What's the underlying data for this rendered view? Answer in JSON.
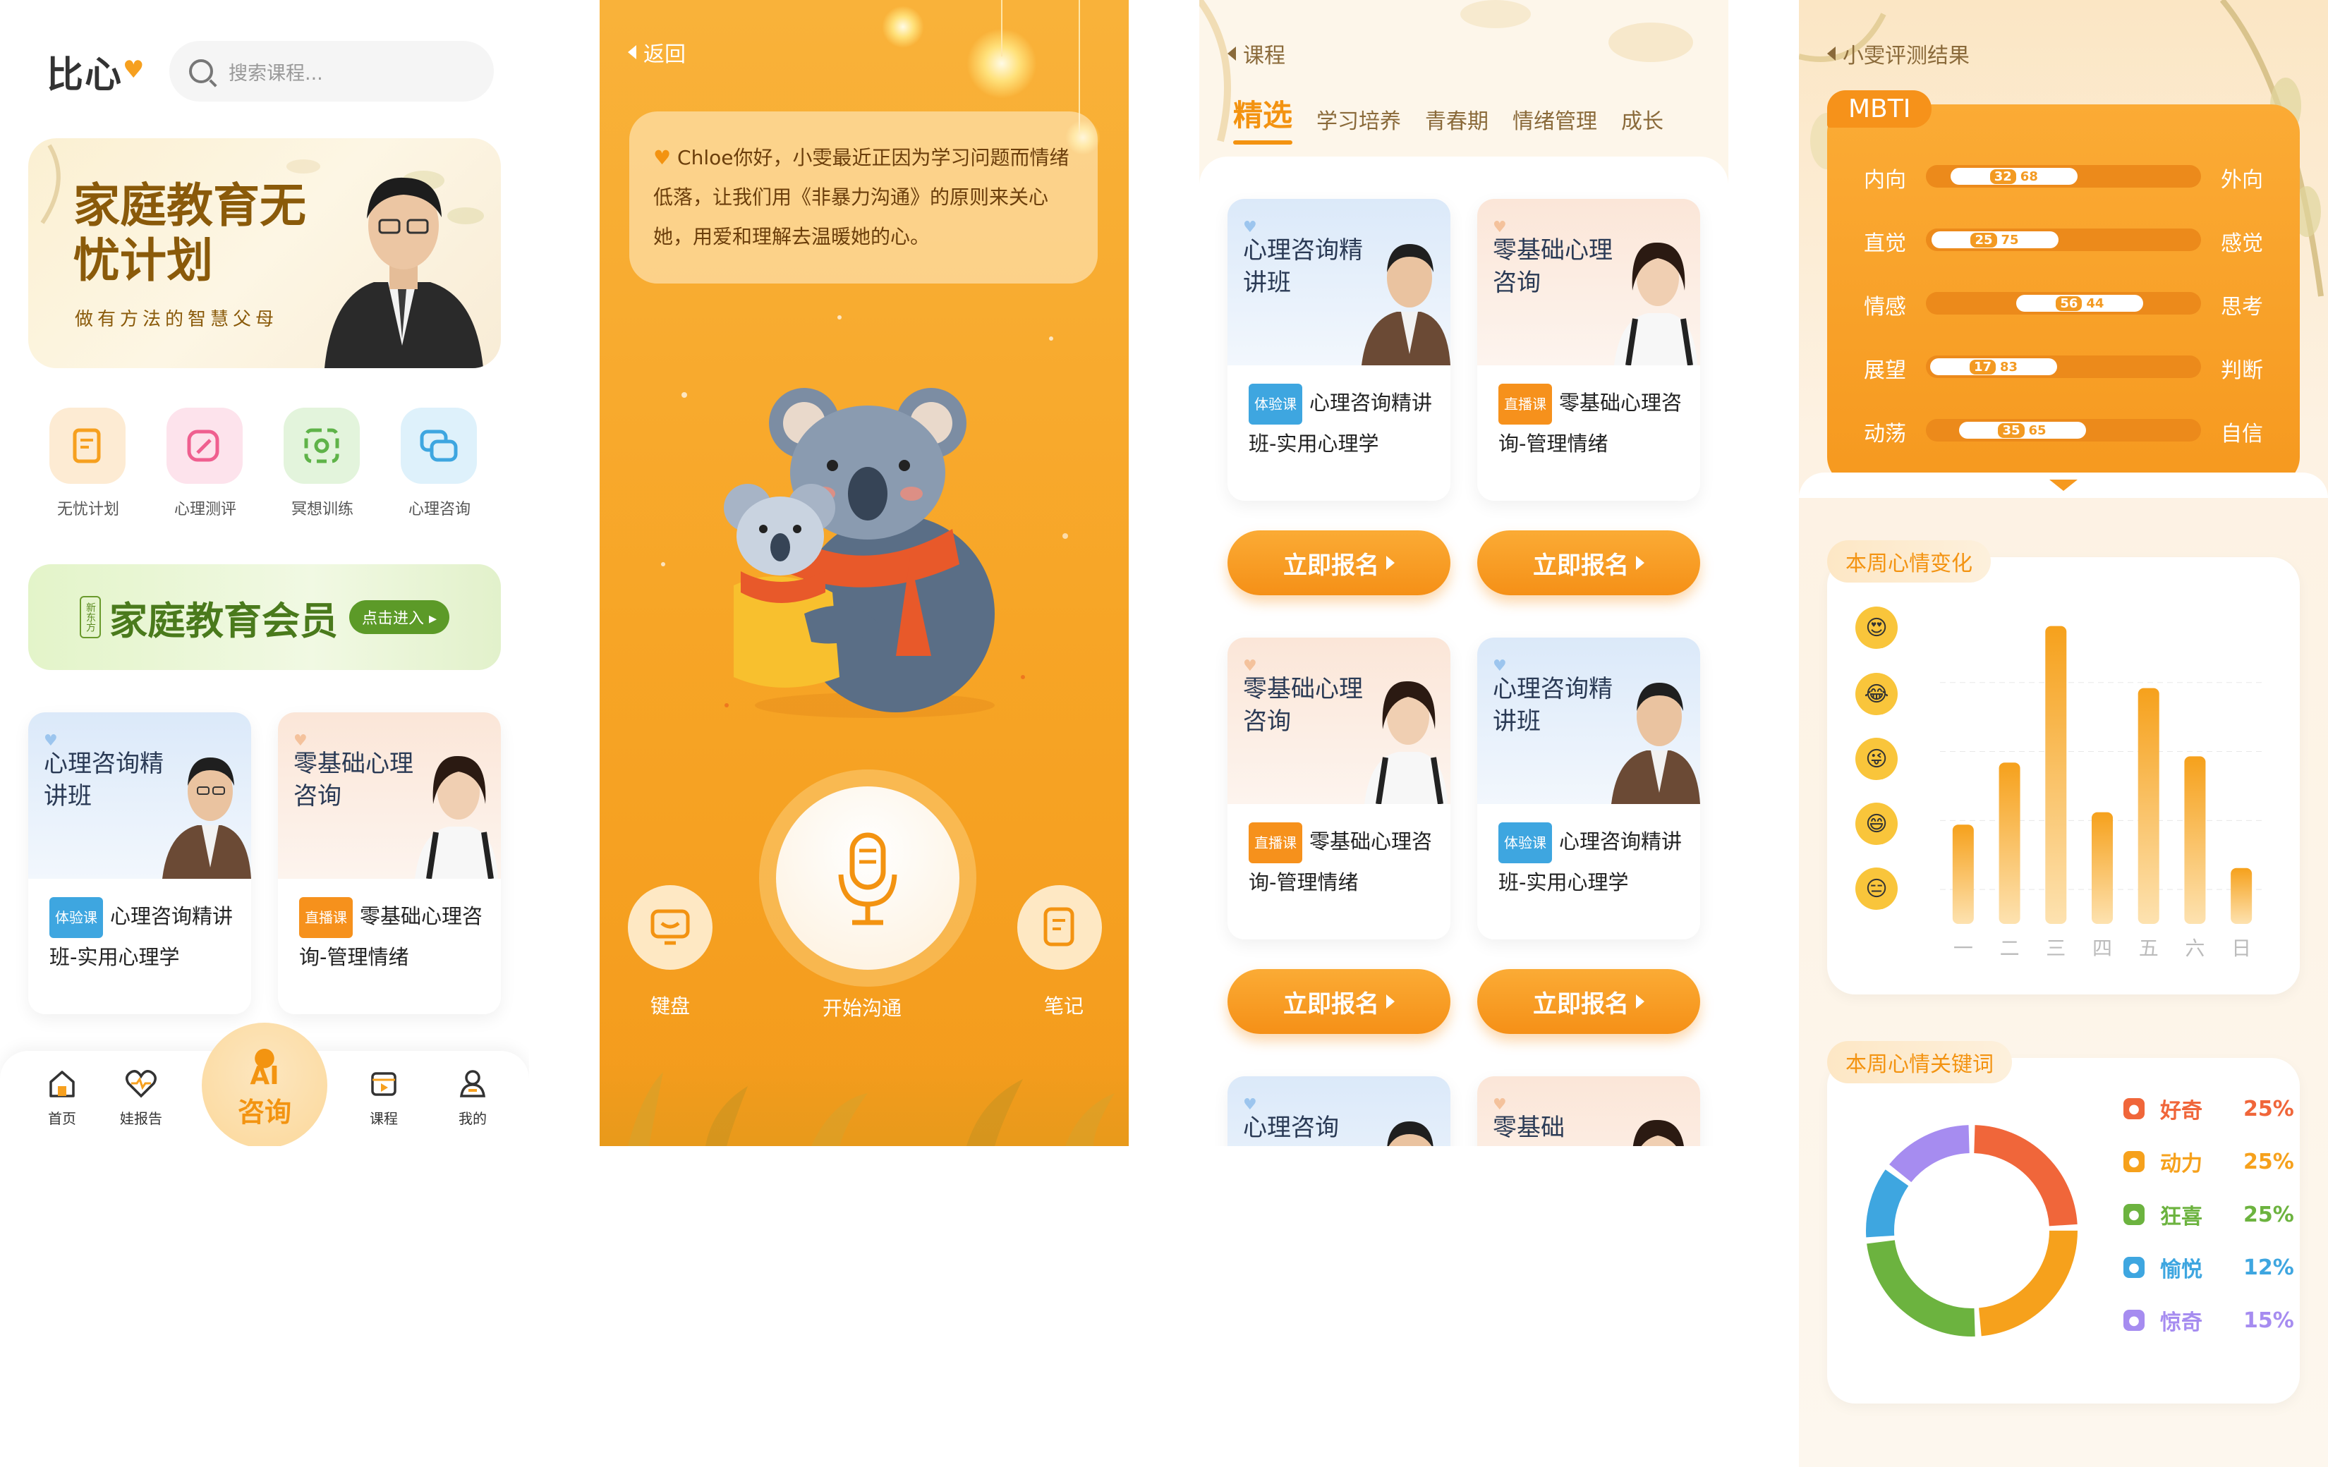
{
  "s1": {
    "logo": "比心",
    "search_placeholder": "搜索课程...",
    "banner": {
      "title": "家庭教育无忧计划",
      "subtitle": "做有方法的智慧父母"
    },
    "grid": [
      {
        "label": "无忧计划",
        "icon": "document-icon",
        "color": "#f6a01f",
        "bg": "#fdebd3"
      },
      {
        "label": "心理测评",
        "icon": "pencil-icon",
        "color": "#ef5f8f",
        "bg": "#fde3ec"
      },
      {
        "label": "冥想训练",
        "icon": "refresh-icon",
        "color": "#5fb349",
        "bg": "#e3f4dc"
      },
      {
        "label": "心理咨询",
        "icon": "chat-icon",
        "color": "#3ea6e0",
        "bg": "#def1fb"
      }
    ],
    "member": {
      "badge": "新东方",
      "text": "家庭教育会员",
      "button": "点击进入"
    },
    "cards": [
      {
        "title": "心理咨询精讲班",
        "tag": "体验课",
        "desc": "心理咨询精讲班-实用心理学"
      },
      {
        "title": "零基础心理咨询",
        "tag": "直播课",
        "desc": "零基础心理咨询-管理情绪"
      }
    ],
    "tabbar": {
      "home": "首页",
      "report": "娃报告",
      "ai_top": "AI",
      "ai_label": "咨询",
      "course": "课程",
      "mine": "我的"
    }
  },
  "s2": {
    "back": "返回",
    "message": "Chloe你好，小雯最近正因为学习问题而情绪低落，让我们用《非暴力沟通》的原则来关心她，用爱和理解去温暖她的心。",
    "keyboard": "键盘",
    "start": "开始沟通",
    "notes": "笔记"
  },
  "s3": {
    "back": "课程",
    "tabs": [
      "精选",
      "学习培养",
      "青春期",
      "情绪管理",
      "成长"
    ],
    "cards": [
      {
        "title": "心理咨询精讲班",
        "tag": "体验课",
        "desc": "心理咨询精讲班-实用心理学"
      },
      {
        "title": "零基础心理咨询",
        "tag": "直播课",
        "desc": "零基础心理咨询-管理情绪"
      },
      {
        "title": "零基础心理咨询",
        "tag": "直播课",
        "desc": "零基础心理咨询-管理情绪"
      },
      {
        "title": "心理咨询精讲班",
        "tag": "体验课",
        "desc": "心理咨询精讲班-实用心理学"
      },
      {
        "title": "心理咨询",
        "tag": "",
        "desc": ""
      },
      {
        "title": "零基础",
        "tag": "",
        "desc": ""
      }
    ],
    "signup": "立即报名"
  },
  "s4": {
    "back": "小雯评测结果",
    "mbti_title": "MBTI",
    "mbti": [
      {
        "left": "内向",
        "right": "外向",
        "a": 32,
        "b": 68
      },
      {
        "left": "直觉",
        "right": "感觉",
        "a": 25,
        "b": 75
      },
      {
        "left": "情感",
        "right": "思考",
        "a": 56,
        "b": 44
      },
      {
        "left": "展望",
        "right": "判断",
        "a": 17,
        "b": 83
      },
      {
        "left": "动荡",
        "right": "自信",
        "a": 35,
        "b": 65
      }
    ],
    "mood_title": "本周心情变化",
    "keywords_title": "本周心情关键词",
    "keywords": [
      {
        "label": "好奇",
        "pct": "25%",
        "color": "#f0663a"
      },
      {
        "label": "动力",
        "pct": "25%",
        "color": "#f6a11c"
      },
      {
        "label": "狂喜",
        "pct": "25%",
        "color": "#6cb33f"
      },
      {
        "label": "愉悦",
        "pct": "12%",
        "color": "#3ea6e0"
      },
      {
        "label": "惊奇",
        "pct": "15%",
        "color": "#a68cf0"
      }
    ]
  },
  "chart_data": [
    {
      "type": "bar",
      "title": "本周心情变化",
      "categories": [
        "一",
        "二",
        "三",
        "四",
        "五",
        "六",
        "日"
      ],
      "values": [
        1.6,
        2.6,
        4.8,
        1.8,
        3.8,
        2.7,
        0.9
      ],
      "ylim": [
        0,
        5
      ]
    },
    {
      "type": "pie",
      "title": "本周心情关键词",
      "categories": [
        "好奇",
        "动力",
        "狂喜",
        "愉悦",
        "惊奇"
      ],
      "values": [
        25,
        25,
        25,
        12,
        15
      ],
      "colors": [
        "#f0663a",
        "#f6a11c",
        "#6cb33f",
        "#3ea6e0",
        "#a68cf0"
      ]
    }
  ]
}
